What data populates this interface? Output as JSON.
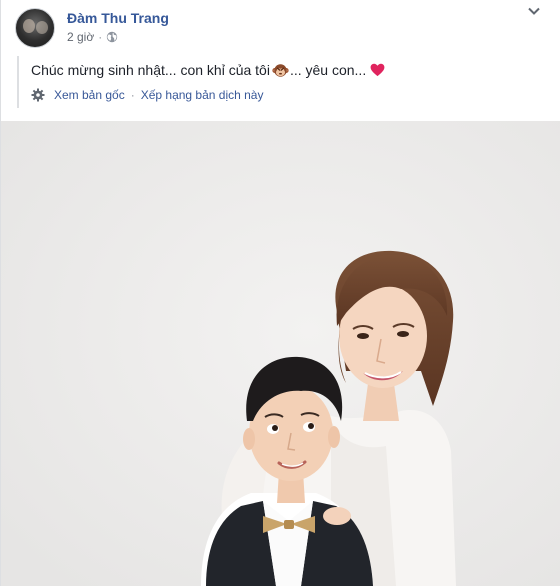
{
  "post": {
    "author": "Đàm Thu Trang",
    "time": "2 giờ",
    "privacy_icon": "globe-icon",
    "menu_icon": "chevron-down-icon",
    "text_part1": "Chúc mừng sinh nhật... con khỉ của tôi",
    "text_part2": "... yêu con...",
    "emoji1": "monkey-face-icon",
    "emoji2": "red-heart-icon"
  },
  "translation": {
    "settings_icon": "gear-icon",
    "see_original": "Xem bản gốc",
    "separator": "·",
    "rate_translation": "Xếp hạng bản dịch này"
  },
  "photo": {
    "subject": "photo"
  },
  "colors": {
    "link": "#365899",
    "secondary_text": "#616770",
    "body_text": "#1d2129",
    "heart": "#e0245e"
  }
}
